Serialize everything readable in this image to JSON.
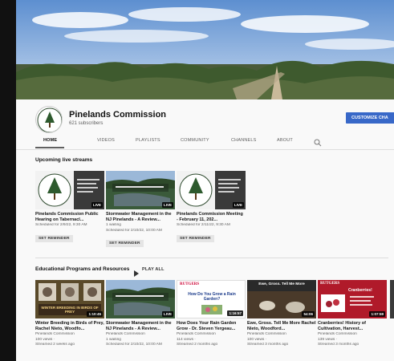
{
  "channel": {
    "name": "Pinelands Commission",
    "subscribers": "621 subscribers",
    "customize_label": "CUSTOMIZE CHA"
  },
  "tabs": [
    {
      "label": "HOME"
    },
    {
      "label": "VIDEOS"
    },
    {
      "label": "PLAYLISTS"
    },
    {
      "label": "COMMUNITY"
    },
    {
      "label": "CHANNELS"
    },
    {
      "label": "ABOUT"
    }
  ],
  "upcoming": {
    "title": "Upcoming live streams",
    "cards": [
      {
        "title": "Pinelands Commission Public Hearing on Tabernacl...",
        "meta1": "Scheduled for 2/9/22, 9:30 AM",
        "meta2": "",
        "badge": "LIVE",
        "button": "SET REMINDER"
      },
      {
        "title": "Stormwater Management in the NJ Pinelands - A Review...",
        "meta1": "1 waiting",
        "meta2": "Scheduled for 2/10/22, 10:00 AM",
        "badge": "LIVE",
        "button": "SET REMINDER"
      },
      {
        "title": "Pinelands Commission Meeting - February 11, 202...",
        "meta1": "Scheduled for 2/11/22, 9:30 AM",
        "meta2": "",
        "badge": "LIVE",
        "button": "SET REMINDER"
      }
    ]
  },
  "educational": {
    "title": "Educational Programs and Resources",
    "play_all": "PLAY ALL",
    "cards": [
      {
        "title": "Winter Breeding in Birds of Prey, Rachel Nieto, Woodfo...",
        "meta1": "Pinelands Commission",
        "meta2": "100 views ·",
        "meta3": "Streamed 2 weeks ago",
        "badge": "1:10:45"
      },
      {
        "title": "Stormwater Management in the NJ Pinelands - A Review...",
        "meta1": "Pinelands Commission",
        "meta2": "1 waiting",
        "meta3": "Scheduled for 2/10/22, 10:00 AM",
        "badge": "LIVE"
      },
      {
        "title": "How Does Your Rain Garden Grow - Dr. Steven Yergeau...",
        "meta1": "Pinelands Commission",
        "meta2": "114 views ·",
        "meta3": "Streamed 2 months ago",
        "badge": "1:16:57"
      },
      {
        "title": "Ewe, Gross. Tell Me More Rachel Nieto, Woodford...",
        "meta1": "Pinelands Commission",
        "meta2": "100 views ·",
        "meta3": "Streamed 3 months ago",
        "badge": "54:06"
      },
      {
        "title": "Cranberries! History of Cultivation, Harvest...",
        "meta1": "Pinelands Commission",
        "meta2": "139 views ·",
        "meta3": "Streamed 3 months ago",
        "badge": "1:07:59"
      }
    ],
    "thumb_text": {
      "birds": "WINTER BREEDING IN BIRDS OF PREY",
      "rutgers": "RUTGERS",
      "rain": "How Do You Grow a Rain Garden?",
      "ewe": "Ewe, Gross. Tell Me More",
      "cran": "Cranberries!"
    }
  },
  "colors": {
    "accent": "#3868c8",
    "badge_bg": "#000000",
    "rutgers_red": "#cc0033"
  }
}
